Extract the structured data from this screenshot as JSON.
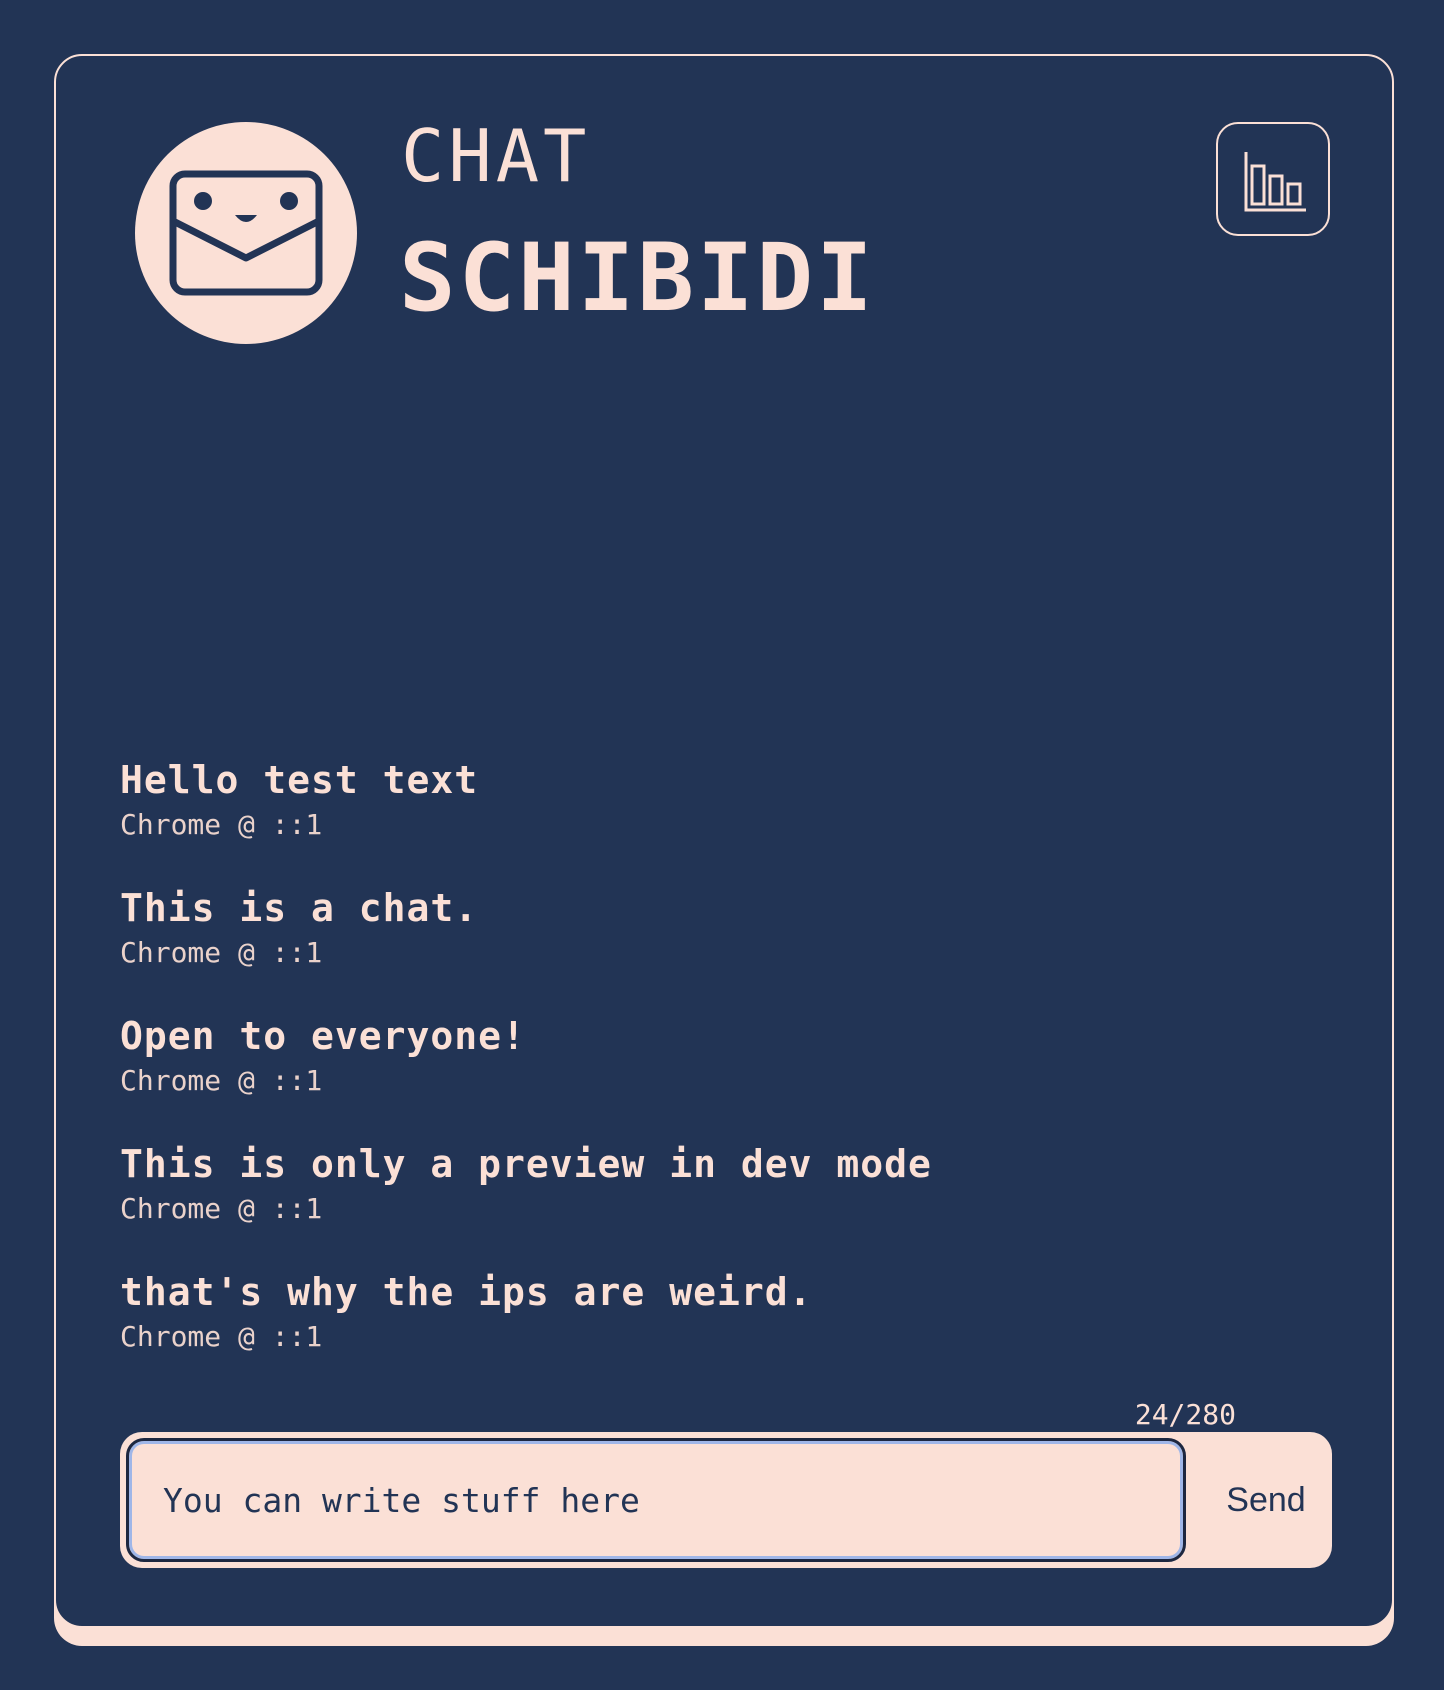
{
  "header": {
    "title_top": "CHAT",
    "title_main": "SCHIBIDI",
    "logo_icon": "smiling-envelope-icon",
    "stats_icon": "bar-chart-icon"
  },
  "messages": [
    {
      "text": "Hello test text",
      "meta": "Chrome @ ::1"
    },
    {
      "text": "This is a chat.",
      "meta": "Chrome @ ::1"
    },
    {
      "text": "Open to everyone!",
      "meta": "Chrome @ ::1"
    },
    {
      "text": "This is only a preview in dev mode",
      "meta": "Chrome @ ::1"
    },
    {
      "text": "that's why the ips are weird.",
      "meta": "Chrome @ ::1"
    }
  ],
  "composer": {
    "counter": "24/280",
    "input_value": "You can write stuff here",
    "send_label": "Send"
  },
  "colors": {
    "background": "#223455",
    "accent": "#fbe0d6",
    "focus_ring": "#9fb6e8"
  }
}
